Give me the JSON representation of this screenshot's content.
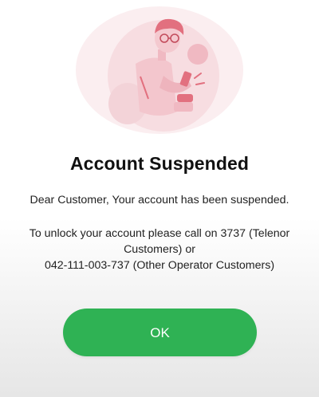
{
  "dialog": {
    "title": "Account Suspended",
    "message_line1": "Dear Customer, Your account has been suspended.",
    "message_para2_line1": "To unlock your account please call on 3737 (Telenor",
    "message_para2_line2": "Customers) or",
    "message_para2_line3": "042-111-003-737 (Other Operator Customers)",
    "ok_label": "OK"
  },
  "illustration": {
    "icon": "person-using-phone-illustration"
  },
  "colors": {
    "accent": "#2fb254",
    "illustration_pink": "#f0b9c2",
    "illustration_red": "#e2707f"
  }
}
